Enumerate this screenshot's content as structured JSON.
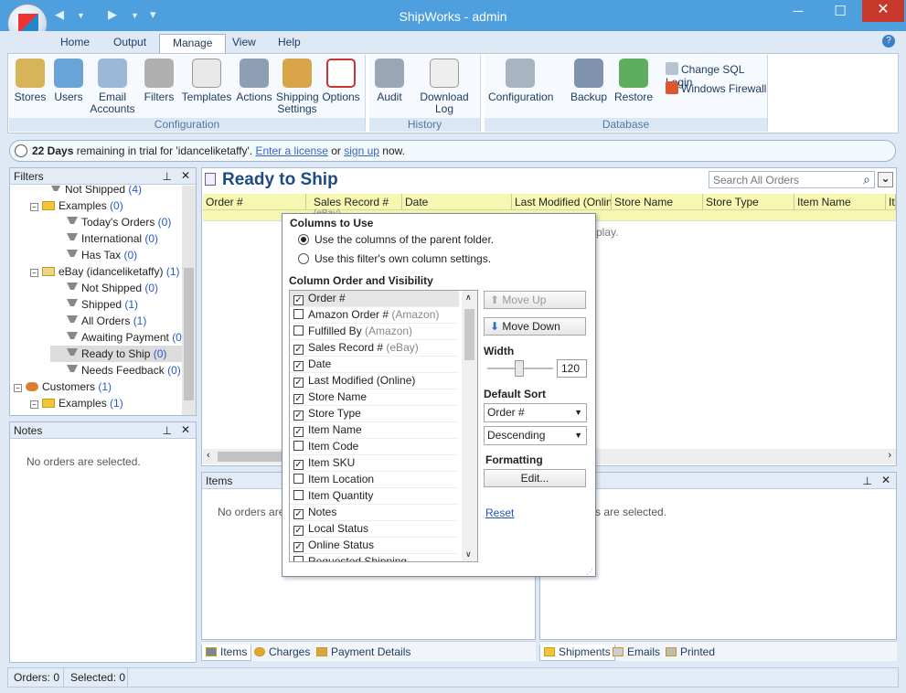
{
  "window": {
    "title": "ShipWorks - admin",
    "minimize": "─",
    "maximize": "☐",
    "close": "✕",
    "help": "?"
  },
  "qat": {
    "back": "◀",
    "arrow1": "▼",
    "fwd": "▶",
    "arrow2": "▼",
    "more": "▾"
  },
  "tabs": [
    "Home",
    "Output",
    "Manage",
    "View",
    "Help"
  ],
  "ribbon": {
    "configuration": {
      "label": "Configuration",
      "buttons": [
        "Stores",
        "Users",
        "Email\nAccounts",
        "Filters",
        "Templates",
        "Actions",
        "Shipping\nSettings",
        "Options"
      ]
    },
    "history": {
      "label": "History",
      "buttons": [
        "Audit",
        "Download Log"
      ]
    },
    "database": {
      "label": "Database",
      "buttons": [
        "Configuration",
        "Backup",
        "Restore"
      ],
      "small": [
        "Change SQL Login",
        "Windows Firewall"
      ]
    }
  },
  "trial": {
    "days": "22 Days",
    "text1": " remaining in trial for 'idanceliketaffy'. ",
    "link1": "Enter a license",
    "text2": " or ",
    "link2": "sign up",
    "text3": " now."
  },
  "filters": {
    "title": "Filters",
    "pin": "⊥",
    "close": "✕",
    "items": [
      {
        "label": "Not Shipped",
        "count": "(4)"
      },
      {
        "label": "Examples",
        "count": "(0)"
      },
      {
        "label": "Today's Orders",
        "count": "(0)"
      },
      {
        "label": "International",
        "count": "(0)"
      },
      {
        "label": "Has Tax",
        "count": "(0)"
      },
      {
        "label": "eBay (idanceliketaffy)",
        "count": "(1)"
      },
      {
        "label": "Not Shipped",
        "count": "(0)"
      },
      {
        "label": "Shipped",
        "count": "(1)"
      },
      {
        "label": "All Orders",
        "count": "(1)"
      },
      {
        "label": "Awaiting Payment",
        "count": "(0)"
      },
      {
        "label": "Ready to Ship",
        "count": "(0)"
      },
      {
        "label": "Needs Feedback",
        "count": "(0)"
      },
      {
        "label": "Customers",
        "count": "(1)"
      },
      {
        "label": "Examples",
        "count": "(1)"
      }
    ],
    "expand": "−"
  },
  "notes": {
    "title": "Notes",
    "empty": "No orders are selected."
  },
  "main": {
    "title": "Ready to Ship",
    "search_placeholder": "Search All Orders",
    "search_icon": "⌕",
    "menu": "⌄",
    "columns": [
      "Order #",
      "Sales Record #",
      "Date",
      "Last Modified (Online)",
      "Store Name",
      "Store Type",
      "Item Name",
      "It"
    ],
    "subhead": "(eBay)",
    "empty": "play."
  },
  "items": {
    "title": "Items",
    "empty": "No orders are",
    "tabs": [
      "Items",
      "Charges",
      "Payment Details"
    ]
  },
  "shipments": {
    "empty": "s are selected.",
    "tabs": [
      "Shipments",
      "Emails",
      "Printed"
    ]
  },
  "status": {
    "orders": "Orders: 0",
    "selected": "Selected: 0"
  },
  "popup": {
    "columns_title": "Columns to Use",
    "opt1": "Use the columns of the parent folder.",
    "opt2": "Use this filter's own column settings.",
    "order_title": "Column Order and Visibility",
    "list": [
      {
        "label": "Order #",
        "sub": "",
        "checked": true
      },
      {
        "label": "Amazon Order #",
        "sub": "(Amazon)",
        "checked": false
      },
      {
        "label": "Fulfilled By",
        "sub": "(Amazon)",
        "checked": false
      },
      {
        "label": "Sales Record #",
        "sub": "(eBay)",
        "checked": true
      },
      {
        "label": "Date",
        "sub": "",
        "checked": true
      },
      {
        "label": "Last Modified (Online)",
        "sub": "",
        "checked": true
      },
      {
        "label": "Store Name",
        "sub": "",
        "checked": true
      },
      {
        "label": "Store Type",
        "sub": "",
        "checked": true
      },
      {
        "label": "Item Name",
        "sub": "",
        "checked": true
      },
      {
        "label": "Item Code",
        "sub": "",
        "checked": false
      },
      {
        "label": "Item SKU",
        "sub": "",
        "checked": true
      },
      {
        "label": "Item Location",
        "sub": "",
        "checked": false
      },
      {
        "label": "Item Quantity",
        "sub": "",
        "checked": false
      },
      {
        "label": "Notes",
        "sub": "",
        "checked": true
      },
      {
        "label": "Local Status",
        "sub": "",
        "checked": true
      },
      {
        "label": "Online Status",
        "sub": "",
        "checked": true
      },
      {
        "label": "Requested Shipping",
        "sub": "",
        "checked": false
      }
    ],
    "move_up": "Move Up",
    "move_down": "Move Down",
    "width_label": "Width",
    "width_value": "120",
    "sort_label": "Default Sort",
    "sort_field": "Order #",
    "sort_dir": "Descending",
    "formatting_label": "Formatting",
    "edit": "Edit...",
    "reset": "Reset"
  }
}
